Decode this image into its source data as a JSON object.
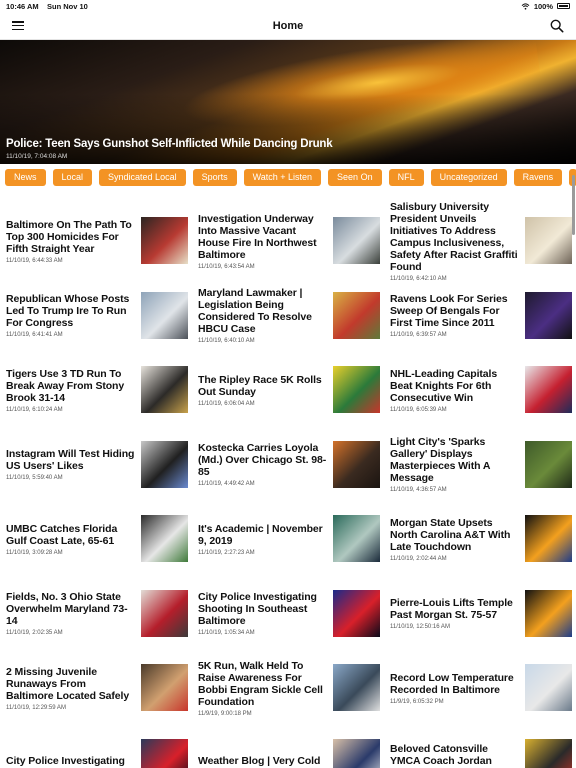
{
  "status": {
    "time": "10:46 AM",
    "date": "Sun Nov 10",
    "battery": "100%"
  },
  "nav": {
    "title": "Home",
    "menu_icon": "hamburger-menu-icon",
    "search_icon": "search-icon"
  },
  "hero": {
    "title": "Police: Teen Says Gunshot Self-Inflicted While Dancing Drunk",
    "date": "11/10/19, 7:04:08 AM"
  },
  "categories": [
    "News",
    "Local",
    "Syndicated Local",
    "Sports",
    "Watch + Listen",
    "Seen On",
    "NFL",
    "Uncategorized",
    "Ravens"
  ],
  "stories": [
    {
      "title": "Baltimore On The Path To Top 300 Homicides For Fifth Straight Year",
      "date": "11/10/19, 6:44:33 AM",
      "thumb": [
        "#2b2522",
        "#b73a32",
        "#e7e0c8"
      ]
    },
    {
      "title": "Investigation Underway Into Massive Vacant House Fire In Northwest Baltimore",
      "date": "11/10/19, 6:43:54 AM",
      "thumb": [
        "#7a8b9c",
        "#d8dde0",
        "#3a3f3a"
      ]
    },
    {
      "title": "Salisbury University President Unveils Initiatives To Address Campus Inclusiveness, Safety After Racist Graffiti Found",
      "date": "11/10/19, 6:42:10 AM",
      "thumb": [
        "#cfc2a8",
        "#f1e9d6",
        "#6e6357"
      ]
    },
    {
      "title": "Republican Whose Posts Led To Trump Ire To Run For Congress",
      "date": "11/10/19, 6:41:41 AM",
      "thumb": [
        "#8ea3b8",
        "#e0e4e8",
        "#4b5058"
      ]
    },
    {
      "title": "Maryland Lawmaker | Legislation Being Considered To Resolve HBCU Case",
      "date": "11/10/19, 6:40:10 AM",
      "thumb": [
        "#d9b245",
        "#c23a2c",
        "#5e7a3a"
      ]
    },
    {
      "title": "Ravens Look For Series Sweep Of Bengals For First Time Since 2011",
      "date": "11/10/19, 6:39:57 AM",
      "thumb": [
        "#1e1a2e",
        "#4b2e83",
        "#111"
      ]
    },
    {
      "title": "Tigers Use 3 TD Run To Break Away From Stony Brook 31-14",
      "date": "11/10/19, 6:10:24 AM",
      "thumb": [
        "#e7e3dc",
        "#2c2a28",
        "#c9a24b"
      ]
    },
    {
      "title": "The Ripley Race 5K Rolls Out Sunday",
      "date": "11/10/19, 6:06:04 AM",
      "thumb": [
        "#e9d02c",
        "#2b7a3a",
        "#c8352b"
      ]
    },
    {
      "title": "NHL-Leading Capitals Beat Knights For 6th Consecutive Win",
      "date": "11/10/19, 6:05:39 AM",
      "thumb": [
        "#e8e8ea",
        "#c52030",
        "#1e2b5a"
      ]
    },
    {
      "title": "Instagram Will Test Hiding US Users' Likes",
      "date": "11/10/19, 5:59:40 AM",
      "thumb": [
        "#c8c8c8",
        "#202020",
        "#6a8ad0"
      ]
    },
    {
      "title": "Kostecka Carries Loyola (Md.) Over Chicago St. 98-85",
      "date": "11/10/19, 4:49:42 AM",
      "thumb": [
        "#d3722a",
        "#3a2a20",
        "#1a1410"
      ]
    },
    {
      "title": "Light City's 'Sparks Gallery' Displays Masterpieces With A Message",
      "date": "11/10/19, 4:36:57 AM",
      "thumb": [
        "#3e5a2a",
        "#6a8a3a",
        "#1f2a18"
      ]
    },
    {
      "title": "UMBC Catches Florida Gulf Coast Late, 65-61",
      "date": "11/10/19, 3:09:28 AM",
      "thumb": [
        "#2a2a2a",
        "#e6e6e6",
        "#3f7a3a"
      ]
    },
    {
      "title": "It's Academic | November 9, 2019",
      "date": "11/10/19, 2:27:23 AM",
      "thumb": [
        "#2a6a5a",
        "#b0c8c0",
        "#1a2a3a"
      ]
    },
    {
      "title": "Morgan State Upsets North Carolina A&T With Late Touchdown",
      "date": "11/10/19, 2:02:44 AM",
      "thumb": [
        "#111111",
        "#f3a01e",
        "#1d3c8a"
      ]
    },
    {
      "title": "Fields, No. 3 Ohio State Overwhelm Maryland 73-14",
      "date": "11/10/19, 2:02:35 AM",
      "thumb": [
        "#e2ddd6",
        "#b51e2b",
        "#3a3a3a"
      ]
    },
    {
      "title": "City Police Investigating Shooting In Southeast Baltimore",
      "date": "11/10/19, 1:05:34 AM",
      "thumb": [
        "#1a2a8a",
        "#d8202a",
        "#0a0a1a"
      ]
    },
    {
      "title": "Pierre-Louis Lifts Temple Past Morgan St. 75-57",
      "date": "11/10/19, 12:50:16 AM",
      "thumb": [
        "#111111",
        "#f3a01e",
        "#1d3c8a"
      ]
    },
    {
      "title": "2 Missing Juvenile Runaways From Baltimore Located Safely",
      "date": "11/10/19, 12:29:59 AM",
      "thumb": [
        "#4a3a2a",
        "#d1a070",
        "#c8352b"
      ]
    },
    {
      "title": "5K Run, Walk Held To Raise Awareness For Bobbi Engram Sickle Cell Foundation",
      "date": "11/9/19, 9:00:18 PM",
      "thumb": [
        "#8aa8c8",
        "#3a4a5a",
        "#e0e0e0"
      ]
    },
    {
      "title": "Record Low Temperature Recorded In Baltimore",
      "date": "11/9/19, 6:05:32 PM",
      "thumb": [
        "#c8d8e8",
        "#e8e8e8",
        "#6a7a8a"
      ]
    },
    {
      "title": "City Police Investigating",
      "date": "",
      "thumb": [
        "#2a3a5a",
        "#d8202a",
        "#0a0a1a"
      ]
    },
    {
      "title": "Weather Blog | Very Cold",
      "date": "",
      "thumb": [
        "#d8c0a8",
        "#2a3a6a",
        "#e8e8e8"
      ]
    },
    {
      "title": "Beloved Catonsville YMCA Coach Jordan Taylor",
      "date": "",
      "thumb": [
        "#d8b030",
        "#2a2a2a",
        "#c8352b"
      ]
    }
  ]
}
